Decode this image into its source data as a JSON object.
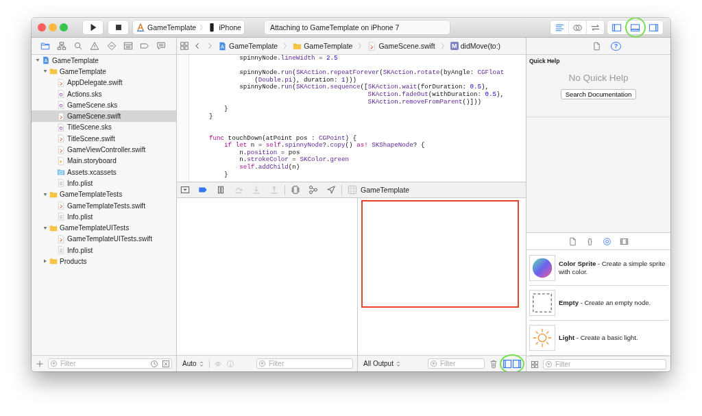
{
  "toolbar": {
    "scheme": {
      "target": "GameTemplate",
      "device": "iPhone"
    },
    "activity": "Attaching to GameTemplate on iPhone 7",
    "editor_modes": [
      {
        "kind": "standard",
        "selected": true
      },
      {
        "kind": "assistant",
        "selected": false
      },
      {
        "kind": "version",
        "selected": false
      }
    ],
    "view_toggles": [
      {
        "kind": "navigator",
        "on": true
      },
      {
        "kind": "debug",
        "on": true,
        "highlighted": true
      },
      {
        "kind": "utilities",
        "on": true
      }
    ]
  },
  "navigator": {
    "tabs": [
      {
        "kind": "project",
        "selected": true
      },
      {
        "kind": "symbols",
        "selected": false
      },
      {
        "kind": "find",
        "selected": false
      },
      {
        "kind": "issues",
        "selected": false
      },
      {
        "kind": "tests",
        "selected": false
      },
      {
        "kind": "debug",
        "selected": false
      },
      {
        "kind": "breakpoints",
        "selected": false
      },
      {
        "kind": "reports",
        "selected": false
      }
    ],
    "tree": [
      {
        "label": "GameTemplate",
        "kind": "project",
        "expanded": true,
        "selected": false,
        "children": [
          {
            "label": "GameTemplate",
            "kind": "folder",
            "expanded": true,
            "selected": false,
            "children": [
              {
                "label": "AppDelegate.swift",
                "kind": "swift",
                "selected": false
              },
              {
                "label": "Actions.sks",
                "kind": "sks",
                "selected": false
              },
              {
                "label": "GameScene.sks",
                "kind": "sks",
                "selected": false
              },
              {
                "label": "GameScene.swift",
                "kind": "swift",
                "selected": true
              },
              {
                "label": "TitleScene.sks",
                "kind": "sks",
                "selected": false
              },
              {
                "label": "TitleScene.swift",
                "kind": "swift",
                "selected": false
              },
              {
                "label": "GameViewController.swift",
                "kind": "swift",
                "selected": false
              },
              {
                "label": "Main.storyboard",
                "kind": "storyboard",
                "selected": false
              },
              {
                "label": "Assets.xcassets",
                "kind": "assets",
                "selected": false
              },
              {
                "label": "Info.plist",
                "kind": "plist",
                "selected": false
              }
            ]
          },
          {
            "label": "GameTemplateTests",
            "kind": "folder",
            "expanded": true,
            "selected": false,
            "children": [
              {
                "label": "GameTemplateTests.swift",
                "kind": "swift",
                "selected": false
              },
              {
                "label": "Info.plist",
                "kind": "plist",
                "selected": false
              }
            ]
          },
          {
            "label": "GameTemplateUITests",
            "kind": "folder",
            "expanded": true,
            "selected": false,
            "children": [
              {
                "label": "GameTemplateUITests.swift",
                "kind": "swift",
                "selected": false
              },
              {
                "label": "Info.plist",
                "kind": "plist",
                "selected": false
              }
            ]
          },
          {
            "label": "Products",
            "kind": "folder",
            "expanded": false,
            "selected": false
          }
        ]
      }
    ],
    "filter": {
      "placeholder": "Filter"
    }
  },
  "editor": {
    "jump_bar": [
      {
        "kind": "project",
        "label": "GameTemplate"
      },
      {
        "kind": "folder",
        "label": "GameTemplate"
      },
      {
        "kind": "swift",
        "label": "GameScene.swift"
      },
      {
        "kind": "method",
        "badge": "M",
        "label": "didMove(to:)"
      }
    ],
    "code_lines": [
      {
        "kind": "code",
        "tokens": [
          {
            "text": "            spinnyNode.",
            "kind": "plain"
          },
          {
            "text": "lineWidth",
            "kind": "type"
          },
          {
            "text": " = ",
            "kind": "plain"
          },
          {
            "text": "2.5",
            "kind": "num"
          }
        ]
      },
      {
        "kind": "blank"
      },
      {
        "kind": "code",
        "tokens": [
          {
            "text": "            spinnyNode.",
            "kind": "plain"
          },
          {
            "text": "run",
            "kind": "type"
          },
          {
            "text": "(",
            "kind": "plain"
          },
          {
            "text": "SKAction",
            "kind": "type"
          },
          {
            "text": ".",
            "kind": "plain"
          },
          {
            "text": "repeatForever",
            "kind": "type"
          },
          {
            "text": "(",
            "kind": "plain"
          },
          {
            "text": "SKAction",
            "kind": "type"
          },
          {
            "text": ".",
            "kind": "plain"
          },
          {
            "text": "rotate",
            "kind": "type"
          },
          {
            "text": "(byAngle: ",
            "kind": "plain"
          },
          {
            "text": "CGFloat",
            "kind": "type"
          }
        ]
      },
      {
        "kind": "code",
        "tokens": [
          {
            "text": "                (",
            "kind": "plain"
          },
          {
            "text": "Double",
            "kind": "type"
          },
          {
            "text": ".",
            "kind": "plain"
          },
          {
            "text": "pi",
            "kind": "type"
          },
          {
            "text": "), duration: ",
            "kind": "plain"
          },
          {
            "text": "1",
            "kind": "num"
          },
          {
            "text": ")))",
            "kind": "plain"
          }
        ]
      },
      {
        "kind": "code",
        "tokens": [
          {
            "text": "            spinnyNode.",
            "kind": "plain"
          },
          {
            "text": "run",
            "kind": "type"
          },
          {
            "text": "(",
            "kind": "plain"
          },
          {
            "text": "SKAction",
            "kind": "type"
          },
          {
            "text": ".",
            "kind": "plain"
          },
          {
            "text": "sequence",
            "kind": "type"
          },
          {
            "text": "([",
            "kind": "plain"
          },
          {
            "text": "SKAction",
            "kind": "type"
          },
          {
            "text": ".",
            "kind": "plain"
          },
          {
            "text": "wait",
            "kind": "type"
          },
          {
            "text": "(forDuration: ",
            "kind": "plain"
          },
          {
            "text": "0.5",
            "kind": "num"
          },
          {
            "text": "),",
            "kind": "plain"
          }
        ]
      },
      {
        "kind": "code",
        "tokens": [
          {
            "text": "                                              SKAction",
            "kind": "type"
          },
          {
            "text": ".",
            "kind": "plain"
          },
          {
            "text": "fadeOut",
            "kind": "type"
          },
          {
            "text": "(withDuration: ",
            "kind": "plain"
          },
          {
            "text": "0.5",
            "kind": "num"
          },
          {
            "text": "),",
            "kind": "plain"
          }
        ]
      },
      {
        "kind": "code",
        "tokens": [
          {
            "text": "                                              SKAction",
            "kind": "type"
          },
          {
            "text": ".",
            "kind": "plain"
          },
          {
            "text": "removeFromParent",
            "kind": "type"
          },
          {
            "text": "()]))",
            "kind": "plain"
          }
        ]
      },
      {
        "kind": "code",
        "tokens": [
          {
            "text": "        }",
            "kind": "plain"
          }
        ]
      },
      {
        "kind": "code",
        "tokens": [
          {
            "text": "    }",
            "kind": "plain"
          }
        ]
      },
      {
        "kind": "blank"
      },
      {
        "kind": "blank"
      },
      {
        "kind": "code",
        "tokens": [
          {
            "text": "    func",
            "kind": "kw"
          },
          {
            "text": " touchDown(atPoint pos : ",
            "kind": "plain"
          },
          {
            "text": "CGPoint",
            "kind": "type"
          },
          {
            "text": ") {",
            "kind": "plain"
          }
        ]
      },
      {
        "kind": "code",
        "tokens": [
          {
            "text": "        if let",
            "kind": "kw"
          },
          {
            "text": " n = ",
            "kind": "plain"
          },
          {
            "text": "self",
            "kind": "kw"
          },
          {
            "text": ".",
            "kind": "plain"
          },
          {
            "text": "spinnyNode",
            "kind": "type"
          },
          {
            "text": "?.",
            "kind": "plain"
          },
          {
            "text": "copy",
            "kind": "type"
          },
          {
            "text": "() ",
            "kind": "plain"
          },
          {
            "text": "as!",
            "kind": "kw"
          },
          {
            "text": " SKShapeNode",
            "kind": "type"
          },
          {
            "text": "? {",
            "kind": "plain"
          }
        ]
      },
      {
        "kind": "code",
        "tokens": [
          {
            "text": "            n.",
            "kind": "plain"
          },
          {
            "text": "position",
            "kind": "type"
          },
          {
            "text": " = pos",
            "kind": "plain"
          }
        ]
      },
      {
        "kind": "code",
        "tokens": [
          {
            "text": "            n.",
            "kind": "plain"
          },
          {
            "text": "strokeColor",
            "kind": "type"
          },
          {
            "text": " = ",
            "kind": "plain"
          },
          {
            "text": "SKColor",
            "kind": "type"
          },
          {
            "text": ".",
            "kind": "plain"
          },
          {
            "text": "green",
            "kind": "type"
          }
        ]
      },
      {
        "kind": "code",
        "tokens": [
          {
            "text": "            self",
            "kind": "kw"
          },
          {
            "text": ".",
            "kind": "plain"
          },
          {
            "text": "addChild",
            "kind": "type"
          },
          {
            "text": "(n)",
            "kind": "plain"
          }
        ]
      },
      {
        "kind": "code",
        "tokens": [
          {
            "text": "        }",
            "kind": "plain"
          }
        ]
      }
    ]
  },
  "debug_bar": {
    "buttons": [
      {
        "kind": "hide",
        "disabled": false
      },
      {
        "kind": "breakpoints",
        "disabled": false,
        "on": true
      },
      {
        "kind": "pause",
        "disabled": false
      },
      {
        "kind": "step-over",
        "disabled": true
      },
      {
        "kind": "step-in",
        "disabled": true
      },
      {
        "kind": "step-out",
        "disabled": true
      },
      {
        "kind": "view-debugger",
        "disabled": false
      },
      {
        "kind": "memory-graph",
        "disabled": false
      },
      {
        "kind": "location",
        "disabled": false
      }
    ],
    "target": "GameTemplate"
  },
  "variables": {
    "scope": "Auto",
    "filter": {
      "placeholder": "Filter"
    }
  },
  "console": {
    "highlighted": true,
    "output": "All Output",
    "filter": {
      "placeholder": "Filter"
    },
    "split_highlighted": true
  },
  "inspector": {
    "tabs": [
      {
        "kind": "file",
        "selected": false
      },
      {
        "kind": "help",
        "glyph": "?",
        "selected": true
      }
    ],
    "quick_help": {
      "heading": "Quick Help",
      "message": "No Quick Help",
      "button": "Search Documentation"
    },
    "library_tabs": [
      {
        "kind": "file",
        "selected": false
      },
      {
        "kind": "code",
        "glyph": "{}",
        "selected": false
      },
      {
        "kind": "object",
        "selected": true
      },
      {
        "kind": "media",
        "selected": false
      }
    ],
    "library_items": [
      {
        "kind": "color-sprite",
        "text": "**Color Sprite** - Create a simple sprite with color."
      },
      {
        "kind": "empty",
        "text": "**Empty** - Create an empty node."
      },
      {
        "kind": "light",
        "text": "**Light** - Create a basic light."
      }
    ],
    "filter": {
      "placeholder": "Filter"
    }
  }
}
